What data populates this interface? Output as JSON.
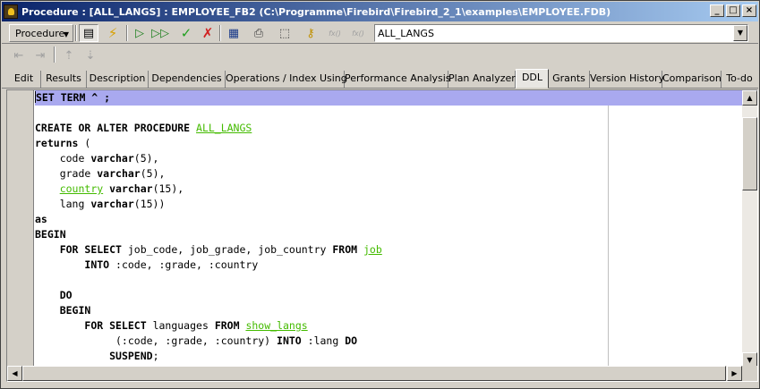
{
  "window": {
    "title": "Procedure : [ALL_LANGS] : EMPLOYEE_FB2 (C:\\Programme\\Firebird\\Firebird_2_1\\examples\\EMPLOYEE.FDB)",
    "minimize": "_",
    "maximize": "□",
    "close": "×"
  },
  "toolbar": {
    "object_type": "Procedure",
    "object_combo": "ALL_LANGS",
    "disabled_a": "fx()",
    "disabled_b": "fx()"
  },
  "tabs": [
    {
      "label": "Edit"
    },
    {
      "label": "Results"
    },
    {
      "label": "Description"
    },
    {
      "label": "Dependencies"
    },
    {
      "label": "Operations / Index Using"
    },
    {
      "label": "Performance Analysis"
    },
    {
      "label": "Plan Analyzer"
    },
    {
      "label": "DDL"
    },
    {
      "label": "Grants"
    },
    {
      "label": "Version History"
    },
    {
      "label": "Comparison"
    },
    {
      "label": "To-do"
    }
  ],
  "code": {
    "l1": "SET TERM ^ ;",
    "l3a": "CREATE OR ALTER PROCEDURE ",
    "l3b": "ALL_LANGS",
    "l4a": "returns",
    "l4b": " (",
    "l5a": "    code ",
    "l5b": "varchar",
    "l5c": "(5),",
    "l6a": "    grade ",
    "l6b": "varchar",
    "l6c": "(5),",
    "l7a": "    ",
    "l7b": "country",
    "l7c": " ",
    "l7d": "varchar",
    "l7e": "(15),",
    "l8a": "    lang ",
    "l8b": "varchar",
    "l8c": "(15))",
    "l9": "as",
    "l10": "BEGIN",
    "l11a": "    ",
    "l11b": "FOR SELECT",
    "l11c": " job_code, job_grade, job_country ",
    "l11d": "FROM",
    "l11e": " ",
    "l11f": "job",
    "l12a": "        ",
    "l12b": "INTO",
    "l12c": " :code, :grade, :country",
    "l14a": "    ",
    "l14b": "DO",
    "l15a": "    ",
    "l15b": "BEGIN",
    "l16a": "        ",
    "l16b": "FOR SELECT",
    "l16c": " languages ",
    "l16d": "FROM",
    "l16e": " ",
    "l16f": "show_langs",
    "l17a": "             (:code, :grade, :country) ",
    "l17b": "INTO",
    "l17c": " :lang ",
    "l17d": "DO",
    "l18a": "            ",
    "l18b": "SUSPEND",
    "l18c": ";"
  }
}
